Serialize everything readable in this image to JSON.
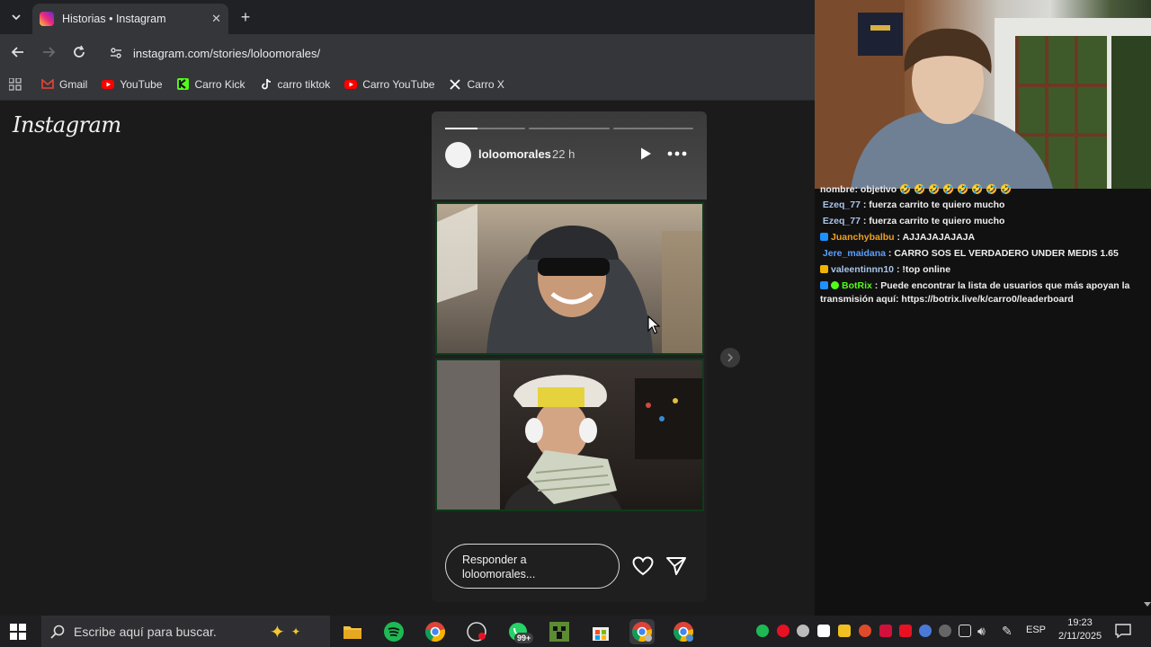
{
  "browser": {
    "tab_title": "Historias • Instagram",
    "url": "instagram.com/stories/loloomorales/",
    "bookmarks": [
      {
        "label": "Gmail",
        "icon": "gmail-icon",
        "color": "#ea4335"
      },
      {
        "label": "YouTube",
        "icon": "youtube-icon",
        "color": "#ff0000"
      },
      {
        "label": "Carro Kick",
        "icon": "kick-icon",
        "color": "#53fc18"
      },
      {
        "label": "carro tiktok",
        "icon": "tiktok-icon",
        "color": "#ffffff"
      },
      {
        "label": "Carro YouTube",
        "icon": "youtube-icon",
        "color": "#ff0000"
      },
      {
        "label": "Carro X",
        "icon": "x-icon",
        "color": "#ffffff"
      }
    ]
  },
  "instagram": {
    "logo": "Instagram",
    "story": {
      "username": "loloomorales",
      "time_ago": "22 h",
      "segments": 3,
      "current_segment": 0,
      "current_progress": 0.4,
      "reply_placeholder": "Responder a loloomorales..."
    }
  },
  "chat": {
    "messages": [
      {
        "user": "",
        "user_color": "#efefef",
        "text": "nombre: objetivo 🤣 🤣 🤣 🤣 🤣 🤣 🤣 🤣",
        "badges": []
      },
      {
        "user": "Ezeq_77",
        "user_color": "#a9c4e8",
        "text": "fuerza carrito te quiero mucho",
        "badges": []
      },
      {
        "user": "Ezeq_77",
        "user_color": "#a9c4e8",
        "text": "fuerza carrito te quiero mucho",
        "badges": []
      },
      {
        "user": "Juanchybalbu",
        "user_color": "#f0a020",
        "text": "AJJAJAJAJAJA",
        "badges": [
          "#1e90ff"
        ]
      },
      {
        "user": "Jere_maidana",
        "user_color": "#5aa0ff",
        "text": "CARRO SOS EL VERDADERO UNDER MEDIS 1.65",
        "badges": []
      },
      {
        "user": "valeentinnn10",
        "user_color": "#a9c4e8",
        "text": "!top online",
        "badges": [
          "#f0b400"
        ]
      },
      {
        "user": "BotRix",
        "user_color": "#53fc18",
        "text": "Puede encontrar la lista de usuarios que más apoyan la transmisión aquí: https://botrix.live/k/carro0/leaderboard",
        "badges": [
          "#1e90ff",
          "#53fc18"
        ]
      }
    ]
  },
  "taskbar": {
    "search_placeholder": "Escribe aquí para buscar.",
    "whatsapp_badge": "99+",
    "language": "ESP",
    "time": "19:23",
    "date": "2/11/2025"
  },
  "colors": {
    "chrome_dark": "#202124",
    "chrome_toolbar": "#35363a",
    "page_bg": "#1b1b1b",
    "accent_kick": "#53fc18"
  }
}
